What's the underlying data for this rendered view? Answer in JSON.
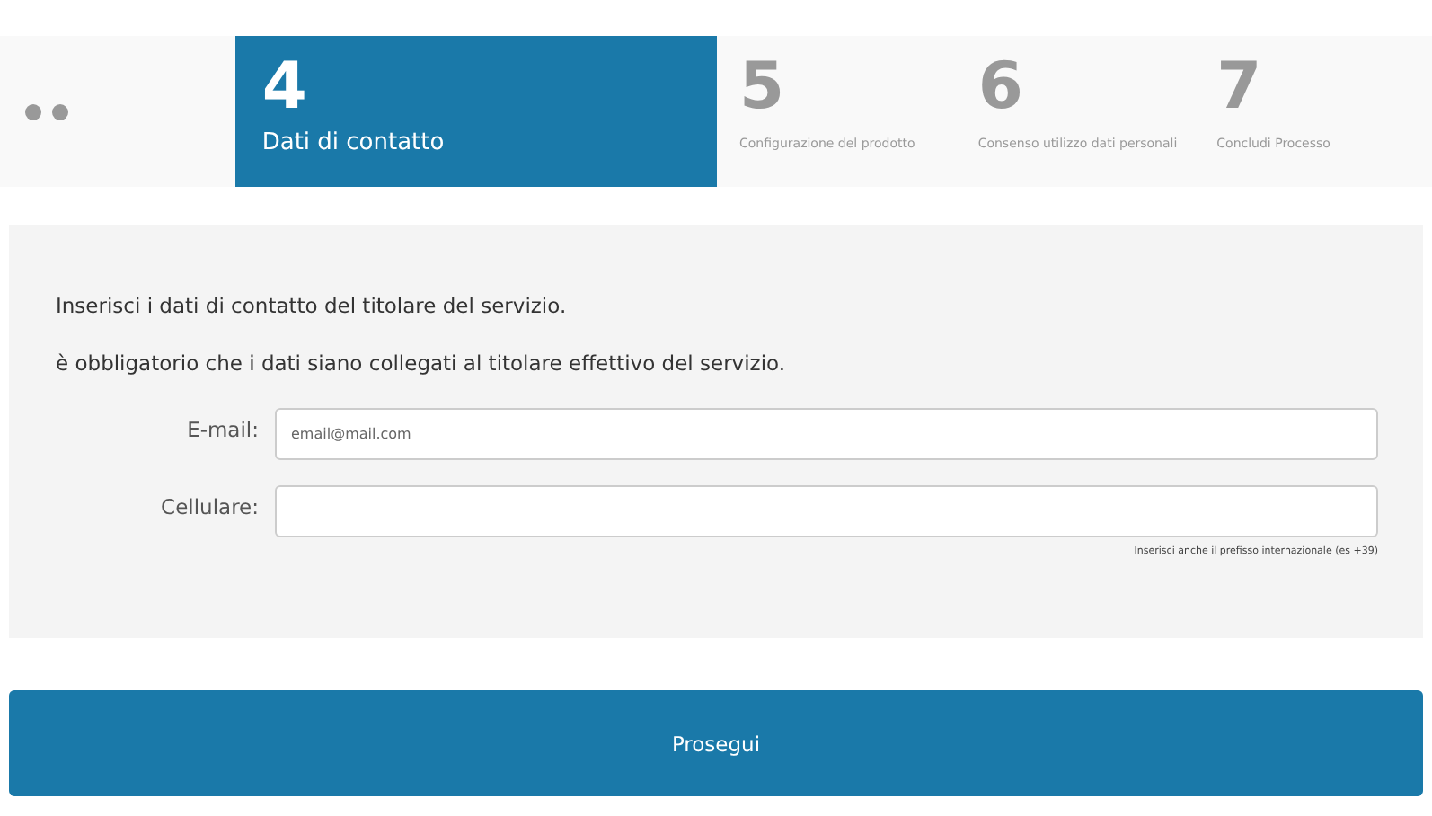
{
  "steps": [
    {
      "number": "4",
      "label": "Dati di contatto",
      "selected": true
    },
    {
      "number": "5",
      "label": "Configurazione del prodotto",
      "selected": false
    },
    {
      "number": "6",
      "label": "Consenso utilizzo dati personali",
      "selected": false
    },
    {
      "number": "7",
      "label": "Concludi Processo",
      "selected": false
    }
  ],
  "form": {
    "intro": "Inserisci i dati di contatto del titolare del servizio.",
    "note": "è obbligatorio che i dati siano collegati al titolare effettivo del servizio.",
    "fields": [
      {
        "label": "E-mail:",
        "placeholder": "email@mail.com"
      },
      {
        "label": "Cellulare:",
        "hint": "Inserisci anche il prefisso internazionale (es +39)"
      }
    ]
  },
  "button": "Prosegui"
}
